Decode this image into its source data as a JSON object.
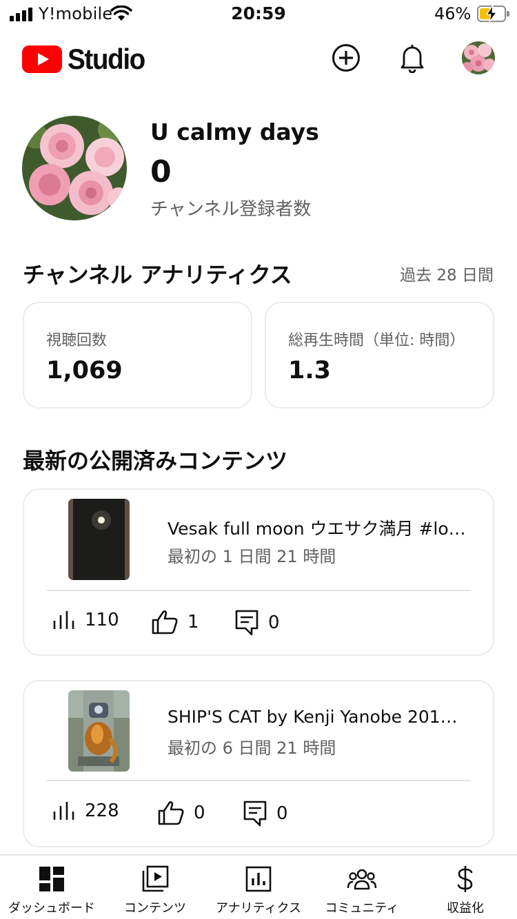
{
  "status_bar": {
    "carrier": "Y!mobile",
    "time": "20:59",
    "battery_percent": "46%",
    "battery_level": 0.46,
    "charging": true
  },
  "header": {
    "logo_text": "Studio",
    "logo_color": "#ff0000",
    "icons": [
      "add-circle-icon",
      "bell-icon",
      "account-avatar"
    ]
  },
  "channel": {
    "name": "U calmy days",
    "subscribers": "0",
    "subscribers_label": "チャンネル登録者数"
  },
  "analytics": {
    "title": "チャンネル アナリティクス",
    "period": "過去 28 日間",
    "cards": [
      {
        "label": "視聴回数",
        "value": "1,069"
      },
      {
        "label": "総再生時間（単位: 時間）",
        "value": "1.3"
      }
    ]
  },
  "latest": {
    "title": "最新の公開済みコンテンツ",
    "items": [
      {
        "title": "Vesak full moon ウエサク満月 #lo…",
        "meta": "最初の 1 日間 21 時間",
        "views": "110",
        "likes": "1",
        "comments": "0"
      },
      {
        "title": "SHIP'S CAT by Kenji Yanobe 201…",
        "meta": "最初の 6 日間 21 時間",
        "views": "228",
        "likes": "0",
        "comments": "0"
      }
    ]
  },
  "bottom_nav": [
    {
      "label": "ダッシュボード",
      "icon": "dashboard-icon"
    },
    {
      "label": "コンテンツ",
      "icon": "content-icon"
    },
    {
      "label": "アナリティクス",
      "icon": "analytics-icon"
    },
    {
      "label": "コミュニティ",
      "icon": "community-icon"
    },
    {
      "label": "収益化",
      "icon": "dollar-icon"
    }
  ]
}
